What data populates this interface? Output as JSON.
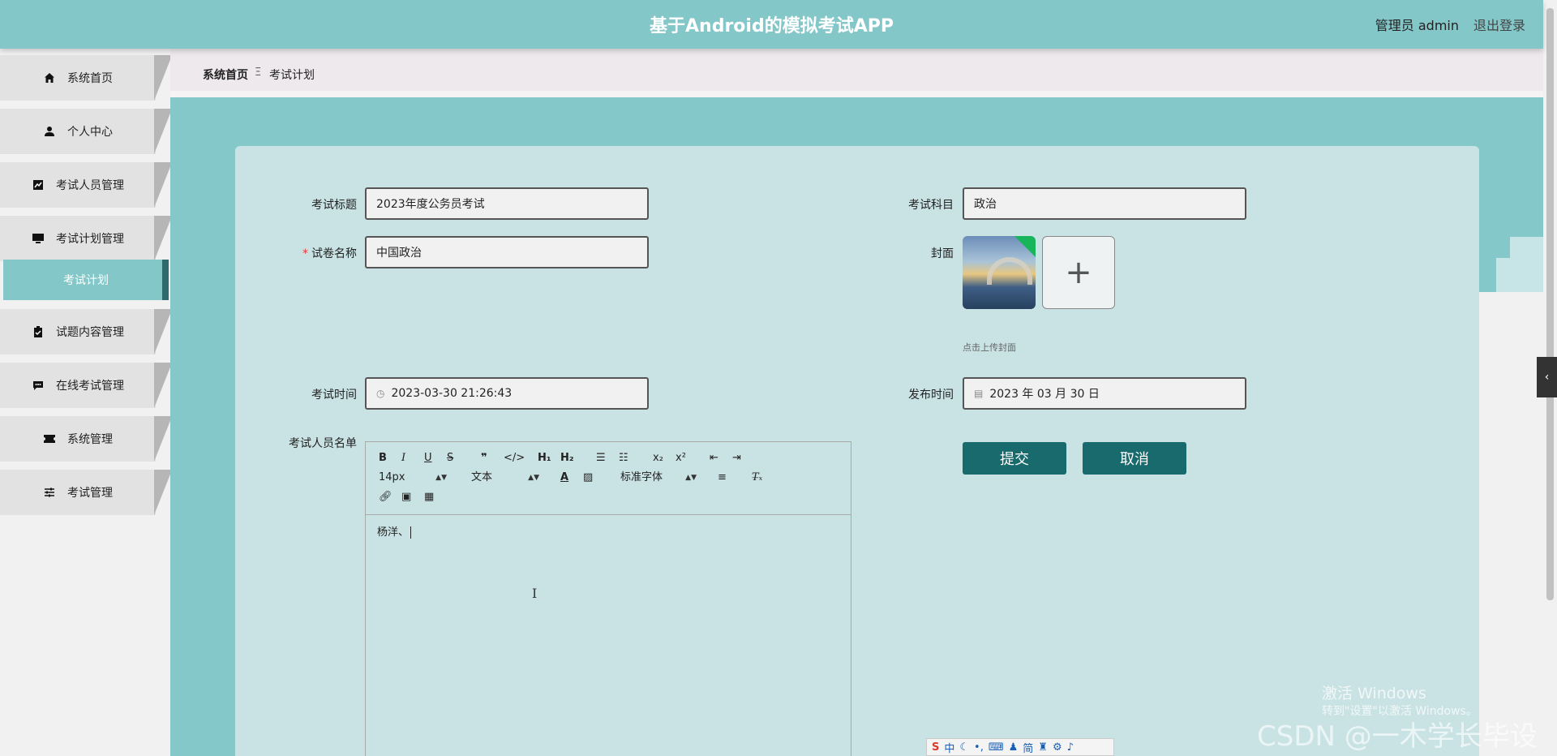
{
  "header": {
    "title": "基于Android的模拟考试APP",
    "user": "管理员 admin",
    "logout": "退出登录"
  },
  "sidebar": {
    "items": [
      {
        "label": "系统首页",
        "icon": "home-icon"
      },
      {
        "label": "个人中心",
        "icon": "user-icon"
      },
      {
        "label": "考试人员管理",
        "icon": "chart-icon"
      },
      {
        "label": "考试计划管理",
        "icon": "monitor-icon"
      },
      {
        "label": "试题内容管理",
        "icon": "clipboard-icon"
      },
      {
        "label": "在线考试管理",
        "icon": "chat-icon"
      },
      {
        "label": "系统管理",
        "icon": "ticket-icon"
      },
      {
        "label": "考试管理",
        "icon": "sliders-icon"
      }
    ],
    "active_sub": "考试计划"
  },
  "breadcrumb": {
    "home": "系统首页",
    "separator": "Ξ",
    "current": "考试计划"
  },
  "form": {
    "title_label": "考试标题",
    "title_value": "2023年度公务员考试",
    "subject_label": "考试科目",
    "subject_value": "政治",
    "paper_label": "试卷名称",
    "paper_value": "中国政治",
    "cover_label": "封面",
    "cover_hint": "点击上传封面",
    "exam_time_label": "考试时间",
    "exam_time_value": "2023-03-30 21:26:43",
    "publish_time_label": "发布时间",
    "publish_time_value": "2023 年 03 月 30 日",
    "examinees_label": "考试人员名单",
    "examinees_value": "杨洋、",
    "submit": "提交",
    "cancel": "取消"
  },
  "editor": {
    "font_size": "14px",
    "block_type": "文本",
    "font_family": "标准字体"
  },
  "watermark": {
    "activate": "激活 Windows",
    "activate_sub": "转到\"设置\"以激活 Windows。",
    "csdn": "CSDN @一木学长毕设"
  },
  "ime": {
    "lang": "中",
    "simplified": "简"
  },
  "colors": {
    "header": "#84c7c9",
    "card": "#c9e2e4",
    "button": "#186a6c",
    "active_menu": "#84c7c9"
  }
}
